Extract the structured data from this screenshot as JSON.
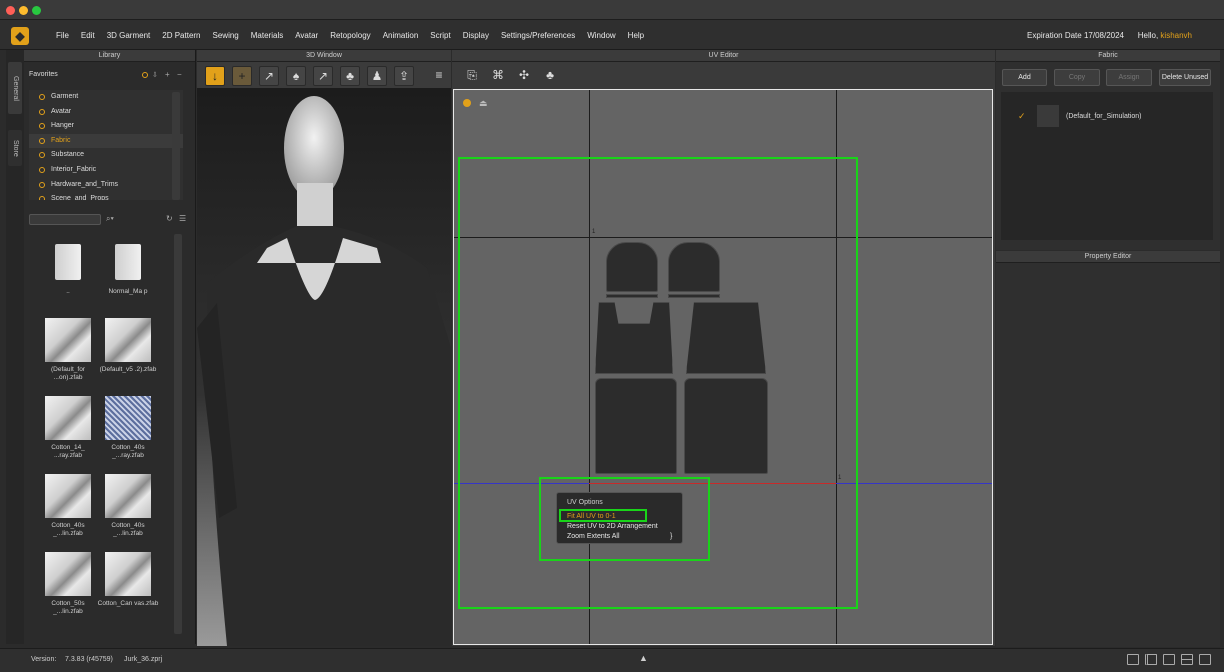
{
  "menu": {
    "items": [
      "File",
      "Edit",
      "3D Garment",
      "2D Pattern",
      "Sewing",
      "Materials",
      "Avatar",
      "Retopology",
      "Animation",
      "Script",
      "Display",
      "Settings/Preferences",
      "Window",
      "Help"
    ],
    "expiration": "Expiration Date 17/08/2024",
    "hello_prefix": "Hello,",
    "user": "kishanvh"
  },
  "side_tabs": [
    "General",
    "Store"
  ],
  "library": {
    "title": "Library",
    "favorites_label": "Favorites",
    "favorites": [
      "Garment",
      "Avatar",
      "Hanger",
      "Fabric",
      "Substance",
      "Interior_Fabric",
      "Hardware_and_Trims",
      "Scene_and_Props"
    ],
    "selected": "Fabric",
    "files": [
      {
        "caption": ".."
      },
      {
        "caption": "Normal_Ma p"
      },
      {
        "caption": "(Default_for ...on).zfab"
      },
      {
        "caption": "(Default_v5 .2).zfab"
      },
      {
        "caption": "Cotton_14_ ...ray.zfab"
      },
      {
        "caption": "Cotton_40s _...ray.zfab"
      },
      {
        "caption": "Cotton_40s _...lin.zfab"
      },
      {
        "caption": "Cotton_40s _...lin.zfab"
      },
      {
        "caption": "Cotton_50s _...lin.zfab"
      },
      {
        "caption": "Cotton_Can vas.zfab"
      }
    ]
  },
  "window3d": {
    "title": "3D Window"
  },
  "uv_editor": {
    "title": "UV Editor",
    "menu_title": "UV Options",
    "menu_items": [
      "Fit All UV to 0-1",
      "Reset UV to 2D Arrangement",
      "Zoom Extents All"
    ],
    "zoom_shortcut": "}",
    "axis_marks": [
      "1",
      "1"
    ]
  },
  "fabric": {
    "title": "Fabric",
    "buttons": [
      "Add",
      "Copy",
      "Assign",
      "Delete Unused"
    ],
    "item": "(Default_for_Simulation)"
  },
  "property_editor": {
    "title": "Property Editor"
  },
  "status": {
    "version_label": "Version:",
    "version": "7.3.83 (r45759)",
    "file": "Jurk_36.zprj"
  },
  "colors": {
    "accent": "#e2a11a",
    "highlight": "#19d419"
  }
}
